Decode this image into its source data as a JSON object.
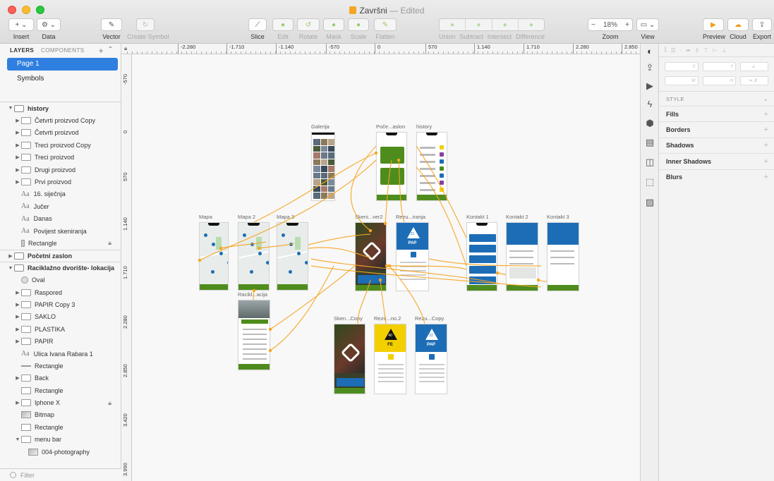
{
  "window": {
    "title": "Završni",
    "title_status": "— Edited"
  },
  "toolbar": {
    "insert": "Insert",
    "data": "Data",
    "vector": "Vector",
    "create_symbol": "Create Symbol",
    "slice": "Slice",
    "edit": "Edit",
    "rotate": "Rotate",
    "mask": "Mask",
    "scale": "Scale",
    "flatten": "Flatten",
    "union": "Union",
    "subtract": "Subtract",
    "intersect": "Intersect",
    "difference": "Difference",
    "zoom_label": "Zoom",
    "zoom_value": "18%",
    "view": "View",
    "preview": "Preview",
    "cloud": "Cloud",
    "export": "Export"
  },
  "left_panel": {
    "tab_layers": "LAYERS",
    "tab_components": "COMPONENTS",
    "pages": [
      "Page 1",
      "Symbols"
    ],
    "filter_placeholder": "Filter",
    "layers": [
      {
        "label": "history",
        "kind": "artboard",
        "depth": 0,
        "expanded": true,
        "group": true
      },
      {
        "label": "Četvrti proizvod Copy",
        "kind": "folder",
        "depth": 1
      },
      {
        "label": "Četvrti proizvod",
        "kind": "folder",
        "depth": 1
      },
      {
        "label": "Treci proizvod Copy",
        "kind": "folder",
        "depth": 1
      },
      {
        "label": "Treci proizvod",
        "kind": "folder",
        "depth": 1
      },
      {
        "label": "Drugi proizvod",
        "kind": "folder",
        "depth": 1
      },
      {
        "label": "Prvi proizvod",
        "kind": "folder",
        "depth": 1
      },
      {
        "label": "16. siječnja",
        "kind": "text",
        "depth": 1
      },
      {
        "label": "Jučer",
        "kind": "text",
        "depth": 1
      },
      {
        "label": "Danas",
        "kind": "text",
        "depth": 1
      },
      {
        "label": "Povijest skeniranja",
        "kind": "text",
        "depth": 1
      },
      {
        "label": "Rectangle",
        "kind": "narrow",
        "depth": 1,
        "locked": true
      },
      {
        "label": "Početni zaslon",
        "kind": "artboard",
        "depth": 0,
        "expanded": false,
        "group": true
      },
      {
        "label": "Raciklažno dvorište- lokacija",
        "kind": "artboard",
        "depth": 0,
        "expanded": true,
        "group": true
      },
      {
        "label": "Oval",
        "kind": "oval",
        "depth": 1
      },
      {
        "label": "Raspored",
        "kind": "folder",
        "depth": 1
      },
      {
        "label": "PAPIR Copy 3",
        "kind": "folder",
        "depth": 1
      },
      {
        "label": "SAKLO",
        "kind": "folder",
        "depth": 1
      },
      {
        "label": "PLASTIKA",
        "kind": "folder",
        "depth": 1
      },
      {
        "label": "PAPIR",
        "kind": "folder",
        "depth": 1
      },
      {
        "label": "Ulica Ivana Rabara 1",
        "kind": "text",
        "depth": 1
      },
      {
        "label": "Rectangle",
        "kind": "line",
        "depth": 1
      },
      {
        "label": "Back",
        "kind": "folder",
        "depth": 1
      },
      {
        "label": "Rectangle",
        "kind": "rect",
        "depth": 1
      },
      {
        "label": "Iphone X",
        "kind": "folder",
        "depth": 1,
        "locked": true
      },
      {
        "label": "Bitmap",
        "kind": "bitmap",
        "depth": 1
      },
      {
        "label": "Rectangle",
        "kind": "rect",
        "depth": 1
      },
      {
        "label": "menu bar",
        "kind": "folder",
        "depth": 1,
        "expanded": true
      },
      {
        "label": "004-photography",
        "kind": "bitmap",
        "depth": 2
      }
    ]
  },
  "ruler": {
    "top_ticks": [
      "-2.280",
      "-1.710",
      "-1.140",
      "-570",
      "0",
      "570",
      "1.140",
      "1.710",
      "2.280",
      "2.850"
    ],
    "left_ticks": [
      "-570",
      "0",
      "570",
      "1.140",
      "1.710",
      "2.280",
      "2.850",
      "3.420",
      "3.990"
    ]
  },
  "artboards": [
    {
      "label": "Galerija",
      "type": "gallery"
    },
    {
      "label": "Poče...aslon",
      "type": "home"
    },
    {
      "label": "history",
      "type": "list"
    },
    {
      "label": "Mapa",
      "type": "map"
    },
    {
      "label": "Mapa 2",
      "type": "map"
    },
    {
      "label": "Mapa 3",
      "type": "map"
    },
    {
      "label": "Skeni...ver2",
      "type": "scan-dark"
    },
    {
      "label": "Rezu...iranja",
      "type": "result-blue",
      "code": "21",
      "tag": "PAP"
    },
    {
      "label": "Kontakt 1",
      "type": "contact-list"
    },
    {
      "label": "Kontakt 2",
      "type": "contact-detail"
    },
    {
      "label": "Kontakt 3",
      "type": "contact-detail"
    },
    {
      "label": "Racikl...acija",
      "type": "location"
    },
    {
      "label": "Sken...Copy",
      "type": "scan-dark"
    },
    {
      "label": "Rezu...no.2",
      "type": "result-yellow",
      "code": "40",
      "tag": "FE"
    },
    {
      "label": "Rezu...Copy",
      "type": "result-blue",
      "code": "22",
      "tag": "PAP"
    }
  ],
  "inspector": {
    "field_x": "X",
    "field_y": "Y",
    "field_w": "W",
    "field_h": "H",
    "style_header": "STYLE",
    "sections": [
      "Fills",
      "Borders",
      "Shadows",
      "Inner Shadows",
      "Blurs"
    ]
  },
  "colors": {
    "selection": "#2f7fe0",
    "flow_arrow": "#f5a623",
    "app_green": "#4e8d1d",
    "app_blue": "#1c6db6",
    "app_yellow": "#f3cf00"
  }
}
